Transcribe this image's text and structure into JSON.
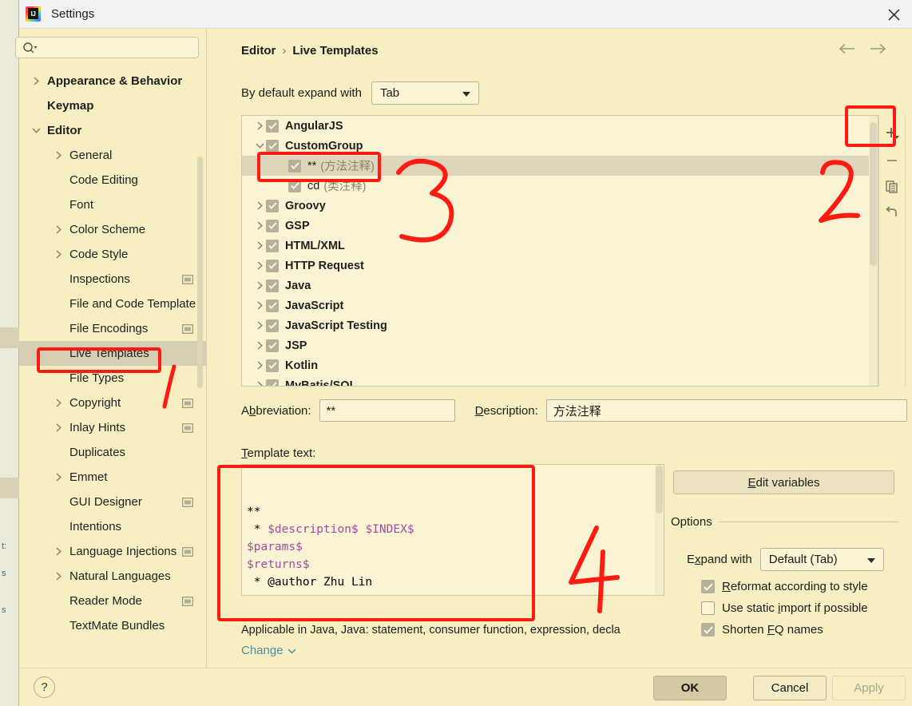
{
  "window": {
    "title": "Settings",
    "logo_icon": "intellij-idea-logo",
    "close_icon": "close-icon"
  },
  "sidebar": {
    "search": {
      "placeholder": "",
      "value": "",
      "icon": "search-icon"
    },
    "items": [
      {
        "label": "Appearance & Behavior",
        "indent": 0,
        "arrow": "chevron-right",
        "bold": true,
        "badge": false,
        "selected": false
      },
      {
        "label": "Keymap",
        "indent": 0,
        "arrow": "none",
        "bold": true,
        "badge": false,
        "selected": false
      },
      {
        "label": "Editor",
        "indent": 0,
        "arrow": "chevron-down",
        "bold": true,
        "badge": false,
        "selected": false
      },
      {
        "label": "General",
        "indent": 1,
        "arrow": "chevron-right",
        "bold": false,
        "badge": false,
        "selected": false
      },
      {
        "label": "Code Editing",
        "indent": 1,
        "arrow": "none",
        "bold": false,
        "badge": false,
        "selected": false
      },
      {
        "label": "Font",
        "indent": 1,
        "arrow": "none",
        "bold": false,
        "badge": false,
        "selected": false
      },
      {
        "label": "Color Scheme",
        "indent": 1,
        "arrow": "chevron-right",
        "bold": false,
        "badge": false,
        "selected": false
      },
      {
        "label": "Code Style",
        "indent": 1,
        "arrow": "chevron-right",
        "bold": false,
        "badge": false,
        "selected": false
      },
      {
        "label": "Inspections",
        "indent": 1,
        "arrow": "none",
        "bold": false,
        "badge": true,
        "selected": false
      },
      {
        "label": "File and Code Template",
        "indent": 1,
        "arrow": "none",
        "bold": false,
        "badge": false,
        "selected": false
      },
      {
        "label": "File Encodings",
        "indent": 1,
        "arrow": "none",
        "bold": false,
        "badge": true,
        "selected": false
      },
      {
        "label": "Live Templates",
        "indent": 1,
        "arrow": "none",
        "bold": false,
        "badge": false,
        "selected": true
      },
      {
        "label": "File Types",
        "indent": 1,
        "arrow": "none",
        "bold": false,
        "badge": false,
        "selected": false
      },
      {
        "label": "Copyright",
        "indent": 1,
        "arrow": "chevron-right",
        "bold": false,
        "badge": true,
        "selected": false
      },
      {
        "label": "Inlay Hints",
        "indent": 1,
        "arrow": "chevron-right",
        "bold": false,
        "badge": true,
        "selected": false
      },
      {
        "label": "Duplicates",
        "indent": 1,
        "arrow": "none",
        "bold": false,
        "badge": false,
        "selected": false
      },
      {
        "label": "Emmet",
        "indent": 1,
        "arrow": "chevron-right",
        "bold": false,
        "badge": false,
        "selected": false
      },
      {
        "label": "GUI Designer",
        "indent": 1,
        "arrow": "none",
        "bold": false,
        "badge": true,
        "selected": false
      },
      {
        "label": "Intentions",
        "indent": 1,
        "arrow": "none",
        "bold": false,
        "badge": false,
        "selected": false
      },
      {
        "label": "Language Injections",
        "indent": 1,
        "arrow": "chevron-right",
        "bold": false,
        "badge": true,
        "selected": false
      },
      {
        "label": "Natural Languages",
        "indent": 1,
        "arrow": "chevron-right",
        "bold": false,
        "badge": false,
        "selected": false
      },
      {
        "label": "Reader Mode",
        "indent": 1,
        "arrow": "none",
        "bold": false,
        "badge": true,
        "selected": false
      },
      {
        "label": "TextMate Bundles",
        "indent": 1,
        "arrow": "none",
        "bold": false,
        "badge": false,
        "selected": false
      }
    ]
  },
  "main": {
    "breadcrumb": {
      "parent": "Editor",
      "separator": "›",
      "current": "Live Templates"
    },
    "nav": {
      "back_icon": "arrow-left-icon",
      "forward_icon": "arrow-right-icon"
    },
    "expand_with": {
      "label": "By default expand with",
      "value": "Tab"
    },
    "templates": [
      {
        "arrow": "chevron-right",
        "checked": true,
        "label": "AngularJS",
        "desc": "",
        "child": false,
        "selected": false
      },
      {
        "arrow": "chevron-down",
        "checked": true,
        "label": "CustomGroup",
        "desc": "",
        "child": false,
        "selected": false
      },
      {
        "arrow": "none",
        "checked": true,
        "label": "**",
        "desc": "(方法注释)",
        "child": true,
        "selected": true
      },
      {
        "arrow": "none",
        "checked": true,
        "label": "cd",
        "desc": "(类注释)",
        "child": true,
        "selected": false
      },
      {
        "arrow": "chevron-right",
        "checked": true,
        "label": "Groovy",
        "desc": "",
        "child": false,
        "selected": false
      },
      {
        "arrow": "chevron-right",
        "checked": true,
        "label": "GSP",
        "desc": "",
        "child": false,
        "selected": false
      },
      {
        "arrow": "chevron-right",
        "checked": true,
        "label": "HTML/XML",
        "desc": "",
        "child": false,
        "selected": false
      },
      {
        "arrow": "chevron-right",
        "checked": true,
        "label": "HTTP Request",
        "desc": "",
        "child": false,
        "selected": false
      },
      {
        "arrow": "chevron-right",
        "checked": true,
        "label": "Java",
        "desc": "",
        "child": false,
        "selected": false
      },
      {
        "arrow": "chevron-right",
        "checked": true,
        "label": "JavaScript",
        "desc": "",
        "child": false,
        "selected": false
      },
      {
        "arrow": "chevron-right",
        "checked": true,
        "label": "JavaScript Testing",
        "desc": "",
        "child": false,
        "selected": false
      },
      {
        "arrow": "chevron-right",
        "checked": true,
        "label": "JSP",
        "desc": "",
        "child": false,
        "selected": false
      },
      {
        "arrow": "chevron-right",
        "checked": true,
        "label": "Kotlin",
        "desc": "",
        "child": false,
        "selected": false
      },
      {
        "arrow": "chevron-right",
        "checked": true,
        "label": "MyBatis/SQL",
        "desc": "",
        "child": false,
        "selected": false
      }
    ],
    "toolbar": [
      {
        "icon": "add-icon",
        "name": "add-template-button"
      },
      {
        "icon": "remove-icon",
        "name": "remove-template-button"
      },
      {
        "icon": "duplicate-icon",
        "name": "duplicate-template-button"
      },
      {
        "icon": "revert-icon",
        "name": "revert-template-button"
      }
    ],
    "abbreviation": {
      "label": "Abbreviation:",
      "value": "**"
    },
    "description": {
      "label": "Description:",
      "value": "方法注释"
    },
    "template_text": {
      "label": "Template text:",
      "lines": [
        {
          "prefix": "**",
          "var1": "",
          "mid": "",
          "var2": "",
          "suffix": ""
        },
        {
          "prefix": " * ",
          "var1": "$description$",
          "mid": " ",
          "var2": "$INDEX$",
          "suffix": ""
        },
        {
          "prefix": "",
          "var1": "$params$",
          "mid": "",
          "var2": "",
          "suffix": ""
        },
        {
          "prefix": "",
          "var1": "$returns$",
          "mid": "",
          "var2": "",
          "suffix": ""
        },
        {
          "prefix": " * @author Zhu Lin",
          "var1": "",
          "mid": "",
          "var2": "",
          "suffix": ""
        }
      ]
    },
    "applicable_text": "Applicable in Java, Java: statement, consumer function, expression, decla",
    "change_link": "Change",
    "change_caret_icon": "chevron-down-icon"
  },
  "options": {
    "edit_variables_button": "Edit variables",
    "title": "Options",
    "expand_with": {
      "label": "Expand with",
      "value": "Default (Tab)"
    },
    "checkboxes": [
      {
        "label": "Reformat according to style",
        "checked": true
      },
      {
        "label": "Use static import if possible",
        "checked": false
      },
      {
        "label": "Shorten FQ names",
        "checked": true
      }
    ]
  },
  "footer": {
    "help_icon": "?",
    "ok": "OK",
    "cancel": "Cancel",
    "apply": "Apply"
  },
  "annotations": {
    "color": "#ff1a12",
    "numbers": [
      "1",
      "2",
      "3",
      "4"
    ]
  },
  "background_hints": [
    "t:",
    "s",
    "s"
  ]
}
